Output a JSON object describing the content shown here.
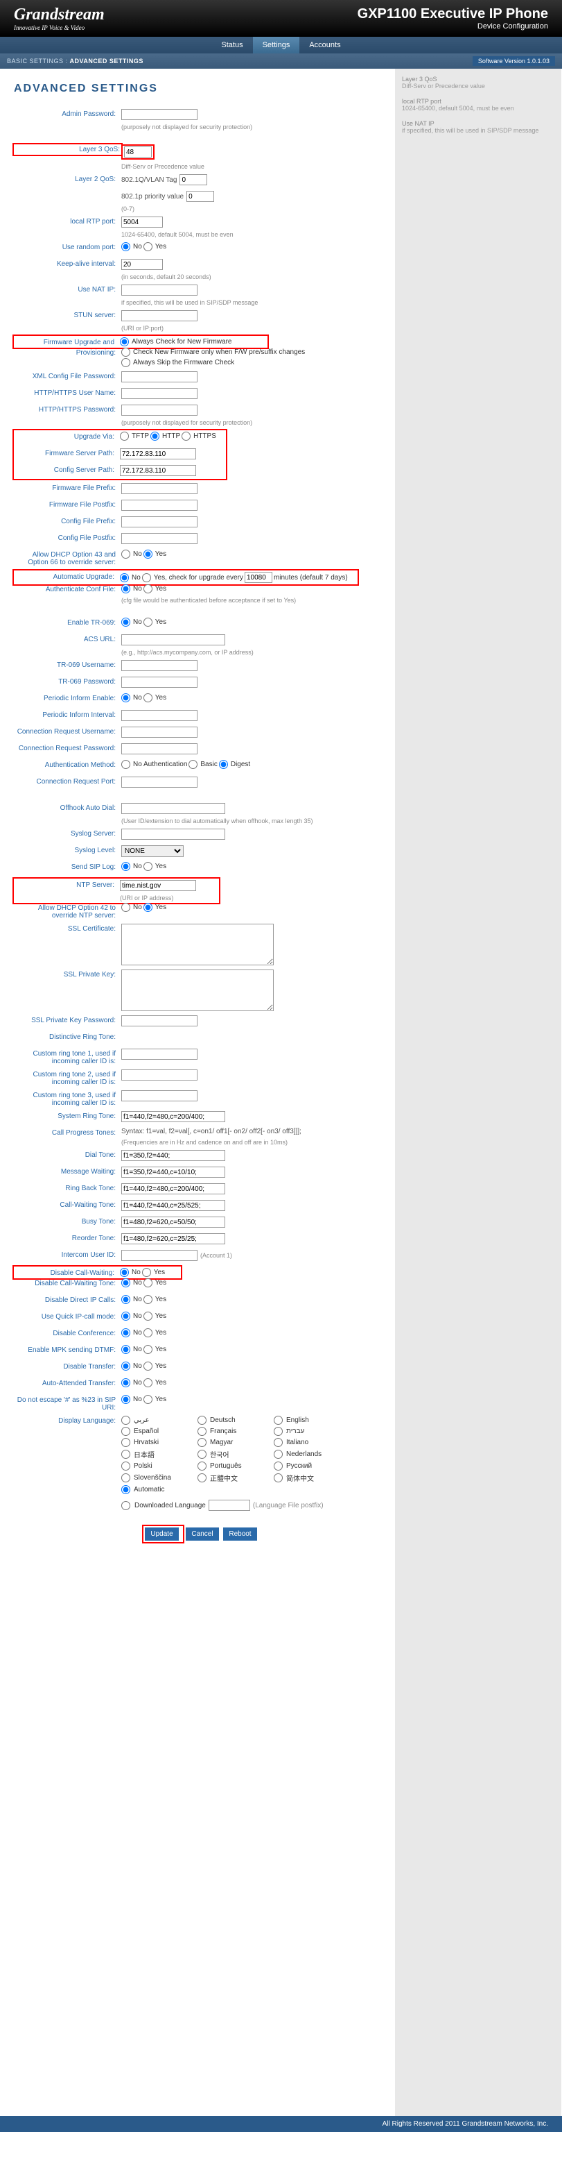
{
  "header": {
    "logo_main": "Grandstream",
    "logo_sub": "Innovative IP Voice & Video",
    "title": "GXP1100 Executive IP Phone",
    "subtitle": "Device Configuration"
  },
  "nav": {
    "items": [
      "Status",
      "Settings",
      "Accounts"
    ],
    "active": "Settings"
  },
  "subnav": {
    "basic": "BASIC SETTINGS",
    "sep": " : ",
    "advanced": "ADVANCED SETTINGS",
    "version": "Software Version 1.0.1.03"
  },
  "page_title": "ADVANCED   SETTINGS",
  "sidebar": {
    "b1": {
      "t": "Layer 3 QoS",
      "d": "Diff-Serv or Precedence value"
    },
    "b2": {
      "t": "local RTP port",
      "d": "1024-65400, default 5004, must be even"
    },
    "b3": {
      "t": "Use NAT IP",
      "d": "if specified, this will be used in SIP/SDP message"
    }
  },
  "labels": {
    "admin_pw": "Admin Password:",
    "layer3": "Layer 3 QoS:",
    "layer2": "Layer 2 QoS:",
    "rtp": "local RTP port:",
    "random": "Use random port:",
    "keepalive": "Keep-alive interval:",
    "natip": "Use NAT IP:",
    "stun": "STUN server:",
    "fwup": "Firmware Upgrade and Provisioning:",
    "xmlpw": "XML Config File Password:",
    "httpuser": "HTTP/HTTPS User Name:",
    "httppw": "HTTP/HTTPS Password:",
    "upvia": "Upgrade Via:",
    "fwsrv": "Firmware Server Path:",
    "cfgsrv": "Config Server Path:",
    "fwpre": "Firmware File Prefix:",
    "fwpost": "Firmware File Postfix:",
    "cfgpre": "Config File Prefix:",
    "cfgpost": "Config File Postfix:",
    "dhcp43": "Allow DHCP Option 43 and Option 66 to override server:",
    "autoup": "Automatic Upgrade:",
    "authcfg": "Authenticate Conf File:",
    "tr069": "Enable TR-069:",
    "acs": "ACS URL:",
    "truser": "TR-069 Username:",
    "trpw": "TR-069 Password:",
    "periodic": "Periodic Inform Enable:",
    "pinterval": "Periodic Inform Interval:",
    "cruser": "Connection Request Username:",
    "crpw": "Connection Request Password:",
    "auth": "Authentication Method:",
    "crport": "Connection Request Port:",
    "offhook": "Offhook Auto Dial:",
    "syslog": "Syslog Server:",
    "loglevel": "Syslog Level:",
    "sendlog": "Send SIP Log:",
    "ntp": "NTP Server:",
    "dhcp42": "Allow DHCP Option 42 to override NTP server:",
    "sslcert": "SSL Certificate:",
    "sslkey": "SSL Private Key:",
    "sslpw": "SSL Private Key Password:",
    "distinctive": "Distinctive Ring Tone:",
    "cring1": "Custom ring tone 1, used if incoming caller ID is:",
    "cring2": "Custom ring tone 2, used if incoming caller ID is:",
    "cring3": "Custom ring tone 3, used if incoming caller ID is:",
    "sysring": "System Ring Tone:",
    "callprog": "Call Progress Tones:",
    "dial": "Dial Tone:",
    "msgwait": "Message Waiting:",
    "ringback": "Ring Back Tone:",
    "callwait": "Call-Waiting Tone:",
    "busy": "Busy Tone:",
    "reorder": "Reorder Tone:",
    "intercom": "Intercom User ID:",
    "dcallwait": "Disable Call-Waiting:",
    "dcallwaitt": "Disable Call-Waiting Tone:",
    "ddip": "Disable Direct IP Calls:",
    "quickip": "Use Quick IP-call mode:",
    "dconf": "Disable Conference:",
    "mpkdtmf": "Enable MPK sending DTMF:",
    "dtransfer": "Disable Transfer:",
    "autoattended": "Auto-Attended Transfer:",
    "escape": "Do not escape '#' as %23 in SIP URI:",
    "displang": "Display Language:"
  },
  "values": {
    "admin_note": "(purposely not displayed for security protection)",
    "layer3": "48",
    "layer3_note": "Diff-Serv or Precedence value",
    "l2_vlan_lbl": "802.1Q/VLAN Tag",
    "l2_vlan": "0",
    "l2_pri_lbl": "802.1p priority value",
    "l2_pri": "0",
    "l2_note": "(0-7)",
    "rtp": "5004",
    "rtp_note": "1024-65400, default 5004, must be even",
    "keepalive": "20",
    "keepalive_note": "(in seconds, default 20 seconds)",
    "natip_note": "if specified, this will be used in SIP/SDP message",
    "stun_note": "(URI or IP:port)",
    "fw_opt1": "Always Check for New Firmware",
    "fw_opt2": "Check New Firmware only when F/W pre/suffix changes",
    "fw_opt3": "Always Skip the Firmware Check",
    "httppw_note": "(purposely not displayed for security protection)",
    "via_tftp": "TFTP",
    "via_http": "HTTP",
    "via_https": "HTTPS",
    "fwsrv": "72.172.83.110",
    "cfgsrv": "72.172.83.110",
    "autoup_pre": "Yes, check for upgrade every",
    "autoup_min": "10080",
    "autoup_post": "minutes (default 7 days)",
    "authcfg_note": "(cfg file would be authenticated before acceptance if set to Yes)",
    "acs_note": "(e.g., http://acs.mycompany.com, or IP address)",
    "auth_none": "No Authentication",
    "auth_basic": "Basic",
    "auth_digest": "Digest",
    "offhook_note": "(User ID/extension to dial automatically when offhook, max length 35)",
    "loglevel": "NONE",
    "ntp": "time.nist.gov",
    "ntp_note": "(URI or IP address)",
    "sysring": "f1=440,f2=480,c=200/400;",
    "callprog_syntax": "Syntax: f1=val, f2=val[, c=on1/ off1[- on2/ off2[- on3/ off3]]];",
    "callprog_note": "(Frequencies are in Hz and cadence on and off are in 10ms)",
    "dial": "f1=350,f2=440;",
    "msgwait": "f1=350,f2=440,c=10/10;",
    "ringback": "f1=440,f2=480,c=200/400;",
    "callwait": "f1=440,f2=440,c=25/525;",
    "busy": "f1=480,f2=620,c=50/50;",
    "reorder": "f1=480,f2=620,c=25/25;",
    "intercom_note": "(Account 1)",
    "no": "No",
    "yes": "Yes",
    "langs": [
      "عربي",
      "Deutsch",
      "English",
      "Español",
      "Français",
      "עברית",
      "Hrvatski",
      "Magyar",
      "Italiano",
      "日本語",
      "한국어",
      "Nederlands",
      "Polski",
      "Português",
      "Русский",
      "Slovenščina",
      "正體中文",
      "简体中文",
      "Automatic"
    ],
    "lang_dl": "Downloaded Language",
    "lang_post": "(Language File postfix)"
  },
  "buttons": {
    "update": "Update",
    "cancel": "Cancel",
    "reboot": "Reboot"
  },
  "footer": "All Rights Reserved 2011 Grandstream Networks, Inc."
}
